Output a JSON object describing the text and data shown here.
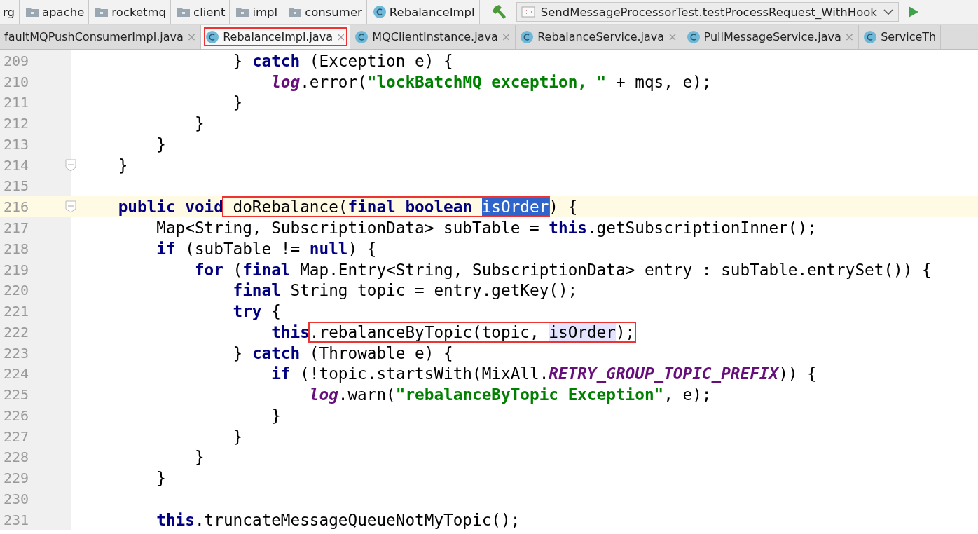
{
  "breadcrumbs": [
    {
      "label": "rg",
      "kind": "plain"
    },
    {
      "label": "apache",
      "kind": "folder"
    },
    {
      "label": "rocketmq",
      "kind": "folder"
    },
    {
      "label": "client",
      "kind": "folder"
    },
    {
      "label": "impl",
      "kind": "folder"
    },
    {
      "label": "consumer",
      "kind": "folder"
    },
    {
      "label": "RebalanceImpl",
      "kind": "class"
    }
  ],
  "run_config": {
    "label": "SendMessageProcessorTest.testProcessRequest_WithHook"
  },
  "tabs": [
    {
      "label": "faultMQPushConsumerImpl.java",
      "close": "×",
      "icon": false,
      "selected": false,
      "annotated": false
    },
    {
      "label": "RebalanceImpl.java",
      "close": "×",
      "icon": true,
      "selected": true,
      "annotated": true
    },
    {
      "label": "MQClientInstance.java",
      "close": "×",
      "icon": true,
      "selected": false,
      "annotated": false
    },
    {
      "label": "RebalanceService.java",
      "close": "×",
      "icon": true,
      "selected": false,
      "annotated": false
    },
    {
      "label": "PullMessageService.java",
      "close": "×",
      "icon": true,
      "selected": false,
      "annotated": false
    },
    {
      "label": "ServiceTh",
      "icon": true,
      "selected": false,
      "annotated": false
    }
  ],
  "editor": {
    "lines": [
      {
        "number": "209",
        "current": false,
        "fold": false,
        "tokens": [
          {
            "kind": "plain",
            "text": "                } "
          },
          {
            "kind": "keyword",
            "text": "catch"
          },
          {
            "kind": "plain",
            "text": " (Exception e) {"
          }
        ]
      },
      {
        "number": "210",
        "current": false,
        "fold": false,
        "tokens": [
          {
            "kind": "field",
            "text": "                    log"
          },
          {
            "kind": "plain",
            "text": ".error("
          },
          {
            "kind": "string",
            "text": "\"lockBatchMQ exception, \""
          },
          {
            "kind": "plain",
            "text": " + mqs, e);"
          }
        ]
      },
      {
        "number": "211",
        "current": false,
        "fold": false,
        "tokens": [
          {
            "kind": "plain",
            "text": "                }"
          }
        ]
      },
      {
        "number": "212",
        "current": false,
        "fold": false,
        "tokens": [
          {
            "kind": "plain",
            "text": "            }"
          }
        ]
      },
      {
        "number": "213",
        "current": false,
        "fold": false,
        "tokens": [
          {
            "kind": "plain",
            "text": "        }"
          }
        ]
      },
      {
        "number": "214",
        "current": false,
        "fold": true,
        "tokens": [
          {
            "kind": "plain",
            "text": "    }"
          }
        ]
      },
      {
        "number": "215",
        "current": false,
        "fold": false
      },
      {
        "number": "216",
        "current": true,
        "fold": true,
        "tokens": [
          {
            "kind": "keyword",
            "text": "    public void"
          },
          {
            "kind": "annotation",
            "tokens": [
              {
                "kind": "plain",
                "text": " doRebalance("
              },
              {
                "kind": "keyword",
                "text": "final boolean "
              },
              {
                "kind": "selection",
                "text": "isOrder"
              }
            ]
          },
          {
            "kind": "plain",
            "text": ") {"
          }
        ]
      },
      {
        "number": "217",
        "current": false,
        "fold": false,
        "tokens": [
          {
            "kind": "plain",
            "text": "        Map<String, SubscriptionData> subTable = "
          },
          {
            "kind": "keyword",
            "text": "this"
          },
          {
            "kind": "plain",
            "text": ".getSubscriptionInner();"
          }
        ]
      },
      {
        "number": "218",
        "current": false,
        "fold": false,
        "tokens": [
          {
            "kind": "keyword",
            "text": "        if"
          },
          {
            "kind": "plain",
            "text": " (subTable != "
          },
          {
            "kind": "keyword",
            "text": "null"
          },
          {
            "kind": "plain",
            "text": ") {"
          }
        ]
      },
      {
        "number": "219",
        "current": false,
        "fold": false,
        "tokens": [
          {
            "kind": "keyword",
            "text": "            for"
          },
          {
            "kind": "plain",
            "text": " ("
          },
          {
            "kind": "keyword",
            "text": "final"
          },
          {
            "kind": "plain",
            "text": " Map.Entry<String, SubscriptionData> entry : subTable.entrySet()) {"
          }
        ]
      },
      {
        "number": "220",
        "current": false,
        "fold": false,
        "tokens": [
          {
            "kind": "keyword",
            "text": "                final"
          },
          {
            "kind": "plain",
            "text": " String topic = entry.getKey();"
          }
        ]
      },
      {
        "number": "221",
        "current": false,
        "fold": false,
        "tokens": [
          {
            "kind": "keyword",
            "text": "                try"
          },
          {
            "kind": "plain",
            "text": " {"
          }
        ]
      },
      {
        "number": "222",
        "current": false,
        "fold": false,
        "tokens": [
          {
            "kind": "keyword",
            "text": "                    this"
          },
          {
            "kind": "annotation",
            "tokens": [
              {
                "kind": "plain",
                "text": ".rebalanceByTopic(topic, "
              },
              {
                "kind": "usage",
                "text": "isOrder"
              },
              {
                "kind": "plain",
                "text": ");"
              }
            ]
          }
        ]
      },
      {
        "number": "223",
        "current": false,
        "fold": false,
        "tokens": [
          {
            "kind": "plain",
            "text": "                } "
          },
          {
            "kind": "keyword",
            "text": "catch"
          },
          {
            "kind": "plain",
            "text": " (Throwable e) {"
          }
        ]
      },
      {
        "number": "224",
        "current": false,
        "fold": false,
        "tokens": [
          {
            "kind": "keyword",
            "text": "                    if"
          },
          {
            "kind": "plain",
            "text": " (!topic.startsWith(MixAll."
          },
          {
            "kind": "constant",
            "text": "RETRY_GROUP_TOPIC_PREFIX"
          },
          {
            "kind": "plain",
            "text": ")) {"
          }
        ]
      },
      {
        "number": "225",
        "current": false,
        "fold": false,
        "tokens": [
          {
            "kind": "field",
            "text": "                        log"
          },
          {
            "kind": "plain",
            "text": ".warn("
          },
          {
            "kind": "string",
            "text": "\"rebalanceByTopic Exception\""
          },
          {
            "kind": "plain",
            "text": ", e);"
          }
        ]
      },
      {
        "number": "226",
        "current": false,
        "fold": false,
        "tokens": [
          {
            "kind": "plain",
            "text": "                    }"
          }
        ]
      },
      {
        "number": "227",
        "current": false,
        "fold": false,
        "tokens": [
          {
            "kind": "plain",
            "text": "                }"
          }
        ]
      },
      {
        "number": "228",
        "current": false,
        "fold": false,
        "tokens": [
          {
            "kind": "plain",
            "text": "            }"
          }
        ]
      },
      {
        "number": "229",
        "current": false,
        "fold": false,
        "tokens": [
          {
            "kind": "plain",
            "text": "        }"
          }
        ]
      },
      {
        "number": "230",
        "current": false,
        "fold": false
      },
      {
        "number": "231",
        "current": false,
        "fold": false,
        "tokens": [
          {
            "kind": "keyword",
            "text": "        this"
          },
          {
            "kind": "plain",
            "text": ".truncateMessageQueueNotMyTopic();"
          }
        ]
      }
    ]
  }
}
